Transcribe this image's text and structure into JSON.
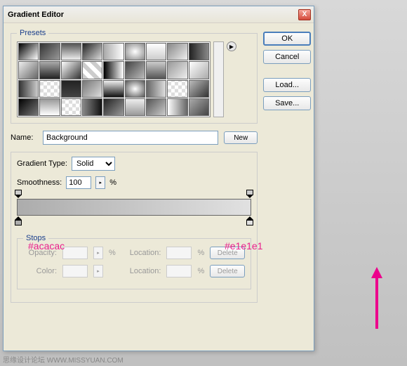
{
  "dialog": {
    "title": "Gradient Editor",
    "close_icon": "X"
  },
  "buttons": {
    "ok": "OK",
    "cancel": "Cancel",
    "load": "Load...",
    "save": "Save...",
    "new": "New",
    "delete": "Delete"
  },
  "presets": {
    "legend": "Presets"
  },
  "name": {
    "label": "Name:",
    "value": "Background"
  },
  "gradient": {
    "type_label": "Gradient Type:",
    "type_value": "Solid",
    "smoothness_label": "Smoothness:",
    "smoothness_value": "100",
    "smoothness_unit": "%",
    "color_left": "#acacac",
    "color_right": "#e1e1e1"
  },
  "stops": {
    "legend": "Stops",
    "opacity_label": "Opacity:",
    "color_label": "Color:",
    "location_label": "Location:",
    "percent": "%"
  },
  "annotations": {
    "hex_left": "#acacac",
    "hex_right": "#e1e1e1"
  },
  "watermark": "思缘设计论坛  WWW.MISSYUAN.COM"
}
